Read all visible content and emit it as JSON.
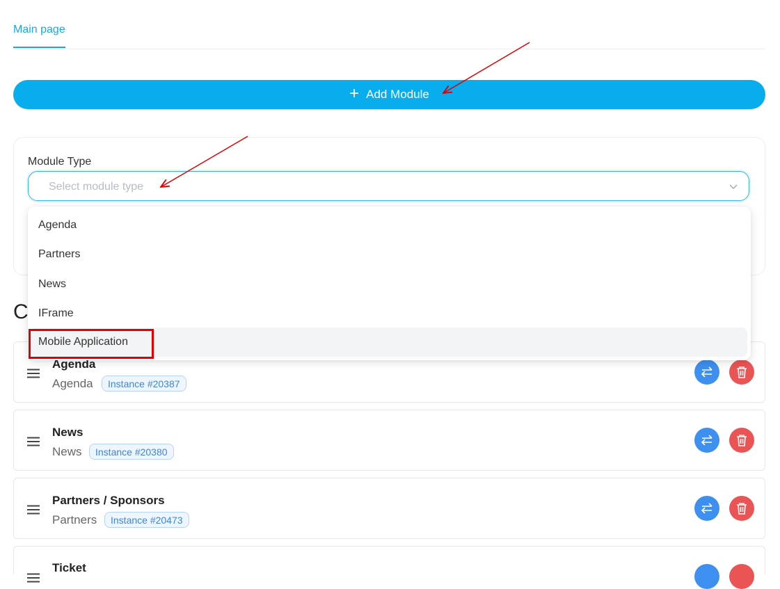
{
  "tabs": [
    {
      "label": "Main page",
      "active": true
    }
  ],
  "add_button": {
    "label": "Add Module",
    "icon": "plus-icon"
  },
  "form": {
    "module_type_label": "Module Type",
    "select_placeholder": "Select module type",
    "options": [
      "Agenda",
      "Partners",
      "News",
      "IFrame",
      "Mobile Application"
    ],
    "highlighted_option": "Mobile Application"
  },
  "section_heading_visible_fragment": "C",
  "modules": [
    {
      "title": "Agenda",
      "type": "Agenda",
      "instance": "Instance #20387"
    },
    {
      "title": "News",
      "type": "News",
      "instance": "Instance #20380"
    },
    {
      "title": "Partners / Sponsors",
      "type": "Partners",
      "instance": "Instance #20473"
    },
    {
      "title": "Ticket",
      "type": "",
      "instance": ""
    }
  ],
  "colors": {
    "accent": "#08adee",
    "swap": "#3d8ff0",
    "delete": "#ea5455",
    "annotation": "#e00000"
  }
}
